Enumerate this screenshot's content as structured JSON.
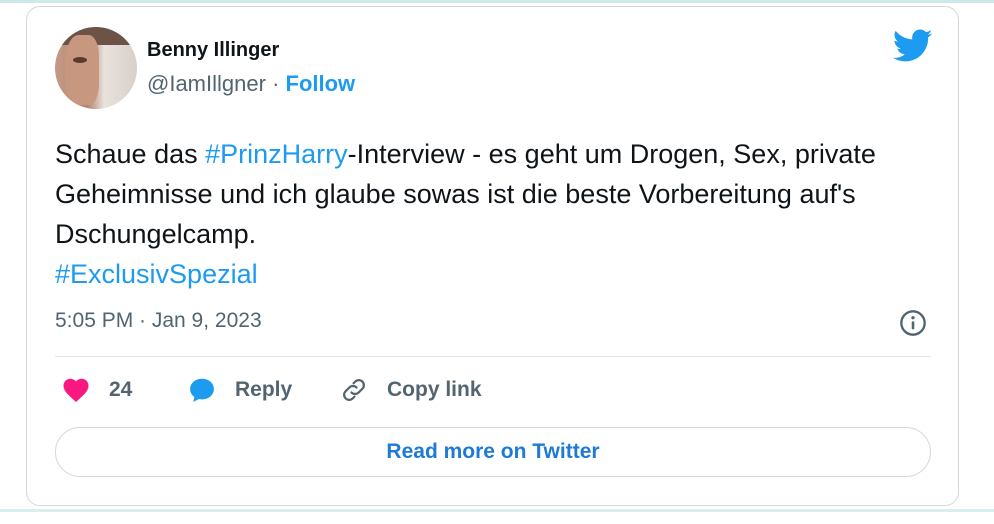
{
  "author": {
    "name": "Benny Illinger",
    "handle": "@IamIllgner",
    "separator": "·",
    "follow_label": "Follow"
  },
  "tweet": {
    "text_part1": "Schaue das ",
    "hashtag1": "#PrinzHarry",
    "text_part2": "-Interview - es geht um Drogen, Sex, private Geheimnisse und ich glaube sowas ist die beste Vorbereitung auf's Dschungelcamp.",
    "hashtag2": "#ExclusivSpezial",
    "timestamp": "5:05 PM · Jan 9, 2023"
  },
  "actions": {
    "likes_count": "24",
    "reply_label": "Reply",
    "copy_link_label": "Copy link"
  },
  "read_more_label": "Read more on Twitter",
  "colors": {
    "twitter_blue": "#1d9bf0",
    "heart_pink": "#f91880",
    "text_dark": "#0f1419",
    "text_gray": "#536471"
  },
  "icons": [
    "twitter-logo-icon",
    "info-icon",
    "heart-icon",
    "reply-bubble-icon",
    "link-icon"
  ]
}
